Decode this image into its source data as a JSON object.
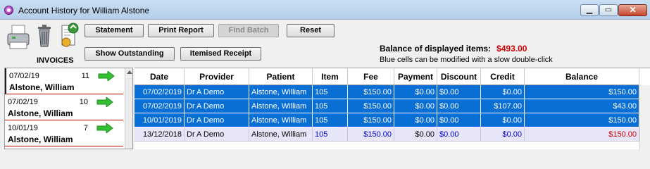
{
  "window": {
    "title": "Account History for William Alstone",
    "min_glyph": "▁",
    "max_glyph": "▭",
    "close_glyph": "✕"
  },
  "toolbar": {
    "statement": "Statement",
    "print_report": "Print Report",
    "find_batch": "Find Batch",
    "reset": "Reset",
    "show_outstanding": "Show Outstanding",
    "itemised_receipt": "Itemised Receipt"
  },
  "balance": {
    "label": "Balance of displayed items:",
    "amount": "$493.00",
    "hint": "Blue cells can be modified with a slow double-click"
  },
  "invoices": {
    "heading": "INVOICES",
    "items": [
      {
        "date": "07/02/19",
        "number": "11",
        "name": "Alstone, William"
      },
      {
        "date": "07/02/19",
        "number": "10",
        "name": "Alstone, William"
      },
      {
        "date": "10/01/19",
        "number": "7",
        "name": "Alstone, William"
      }
    ]
  },
  "grid": {
    "columns": [
      "Date",
      "Provider",
      "Patient",
      "Item",
      "Fee",
      "Payment",
      "Discount",
      "Credit",
      "Balance"
    ],
    "rows": [
      {
        "date": "07/02/2019",
        "provider": "Dr A Demo",
        "patient": "Alstone, William",
        "item": "105",
        "fee": "$150.00",
        "payment": "$0.00",
        "discount": "$0.00",
        "credit": "$0.00",
        "balance": "$150.00"
      },
      {
        "date": "07/02/2019",
        "provider": "Dr A Demo",
        "patient": "Alstone, William",
        "item": "105",
        "fee": "$150.00",
        "payment": "$0.00",
        "discount": "$0.00",
        "credit": "$107.00",
        "balance": "$43.00"
      },
      {
        "date": "10/01/2019",
        "provider": "Dr A Demo",
        "patient": "Alstone, William",
        "item": "105",
        "fee": "$150.00",
        "payment": "$0.00",
        "discount": "$0.00",
        "credit": "$0.00",
        "balance": "$150.00"
      },
      {
        "date": "13/12/2018",
        "provider": "Dr A Demo",
        "patient": "Alstone, William",
        "item": "105",
        "fee": "$150.00",
        "payment": "$0.00",
        "discount": "$0.00",
        "credit": "$0.00",
        "balance": "$150.00"
      }
    ]
  },
  "colors": {
    "selection": "#0a6fd5",
    "balance_amount": "#d00000",
    "editable_text": "#0000cc",
    "negative_balance": "#cc0000",
    "invoice_separator": "#c00000",
    "arrow": "#33c033"
  }
}
